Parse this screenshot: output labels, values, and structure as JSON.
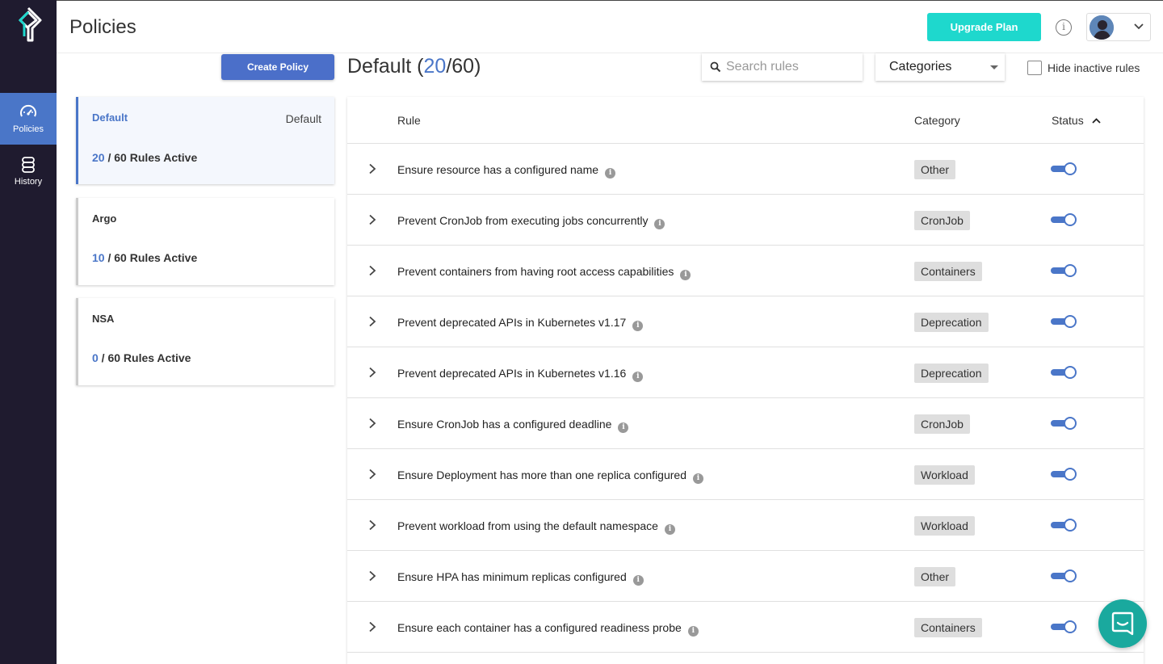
{
  "nav": {
    "items": [
      {
        "label": "Policies",
        "icon": "dashboard-gauge-icon",
        "active": true
      },
      {
        "label": "History",
        "icon": "database-icon",
        "active": false
      }
    ]
  },
  "header": {
    "title": "Policies",
    "upgrade_label": "Upgrade Plan",
    "info_glyph": "i"
  },
  "toolbar": {
    "create_label": "Create Policy",
    "policy_name": "Default",
    "active_count": "20",
    "total_count": "60",
    "search_placeholder": "Search rules",
    "categories_label": "Categories",
    "hide_inactive_label": "Hide inactive rules"
  },
  "policies": [
    {
      "name": "Default",
      "tag": "Default",
      "active": "20",
      "rest": " / 60 Rules Active"
    },
    {
      "name": "Argo",
      "tag": "",
      "active": "10",
      "rest": " / 60 Rules Active"
    },
    {
      "name": "NSA",
      "tag": "",
      "active": "0",
      "rest": " / 60 Rules Active"
    }
  ],
  "table": {
    "columns": [
      "Rule",
      "Category",
      "Status"
    ],
    "rows": [
      {
        "rule": "Ensure resource has a configured name",
        "category": "Other",
        "enabled": true
      },
      {
        "rule": "Prevent CronJob from executing jobs concurrently",
        "category": "CronJob",
        "enabled": true
      },
      {
        "rule": "Prevent containers from having root access capabilities",
        "category": "Containers",
        "enabled": true
      },
      {
        "rule": "Prevent deprecated APIs in Kubernetes v1.17",
        "category": "Deprecation",
        "enabled": true
      },
      {
        "rule": "Prevent deprecated APIs in Kubernetes v1.16",
        "category": "Deprecation",
        "enabled": true
      },
      {
        "rule": "Ensure CronJob has a configured deadline",
        "category": "CronJob",
        "enabled": true
      },
      {
        "rule": "Ensure Deployment has more than one replica configured",
        "category": "Workload",
        "enabled": true
      },
      {
        "rule": "Prevent workload from using the default namespace",
        "category": "Workload",
        "enabled": true
      },
      {
        "rule": "Ensure HPA has minimum replicas configured",
        "category": "Other",
        "enabled": true
      },
      {
        "rule": "Ensure each container has a configured readiness probe",
        "category": "Containers",
        "enabled": true
      }
    ]
  },
  "colors": {
    "nav_bg": "#1f1b2f",
    "accent": "#4a76c8",
    "upgrade": "#1ed8cd",
    "chat": "#1aa99e"
  }
}
